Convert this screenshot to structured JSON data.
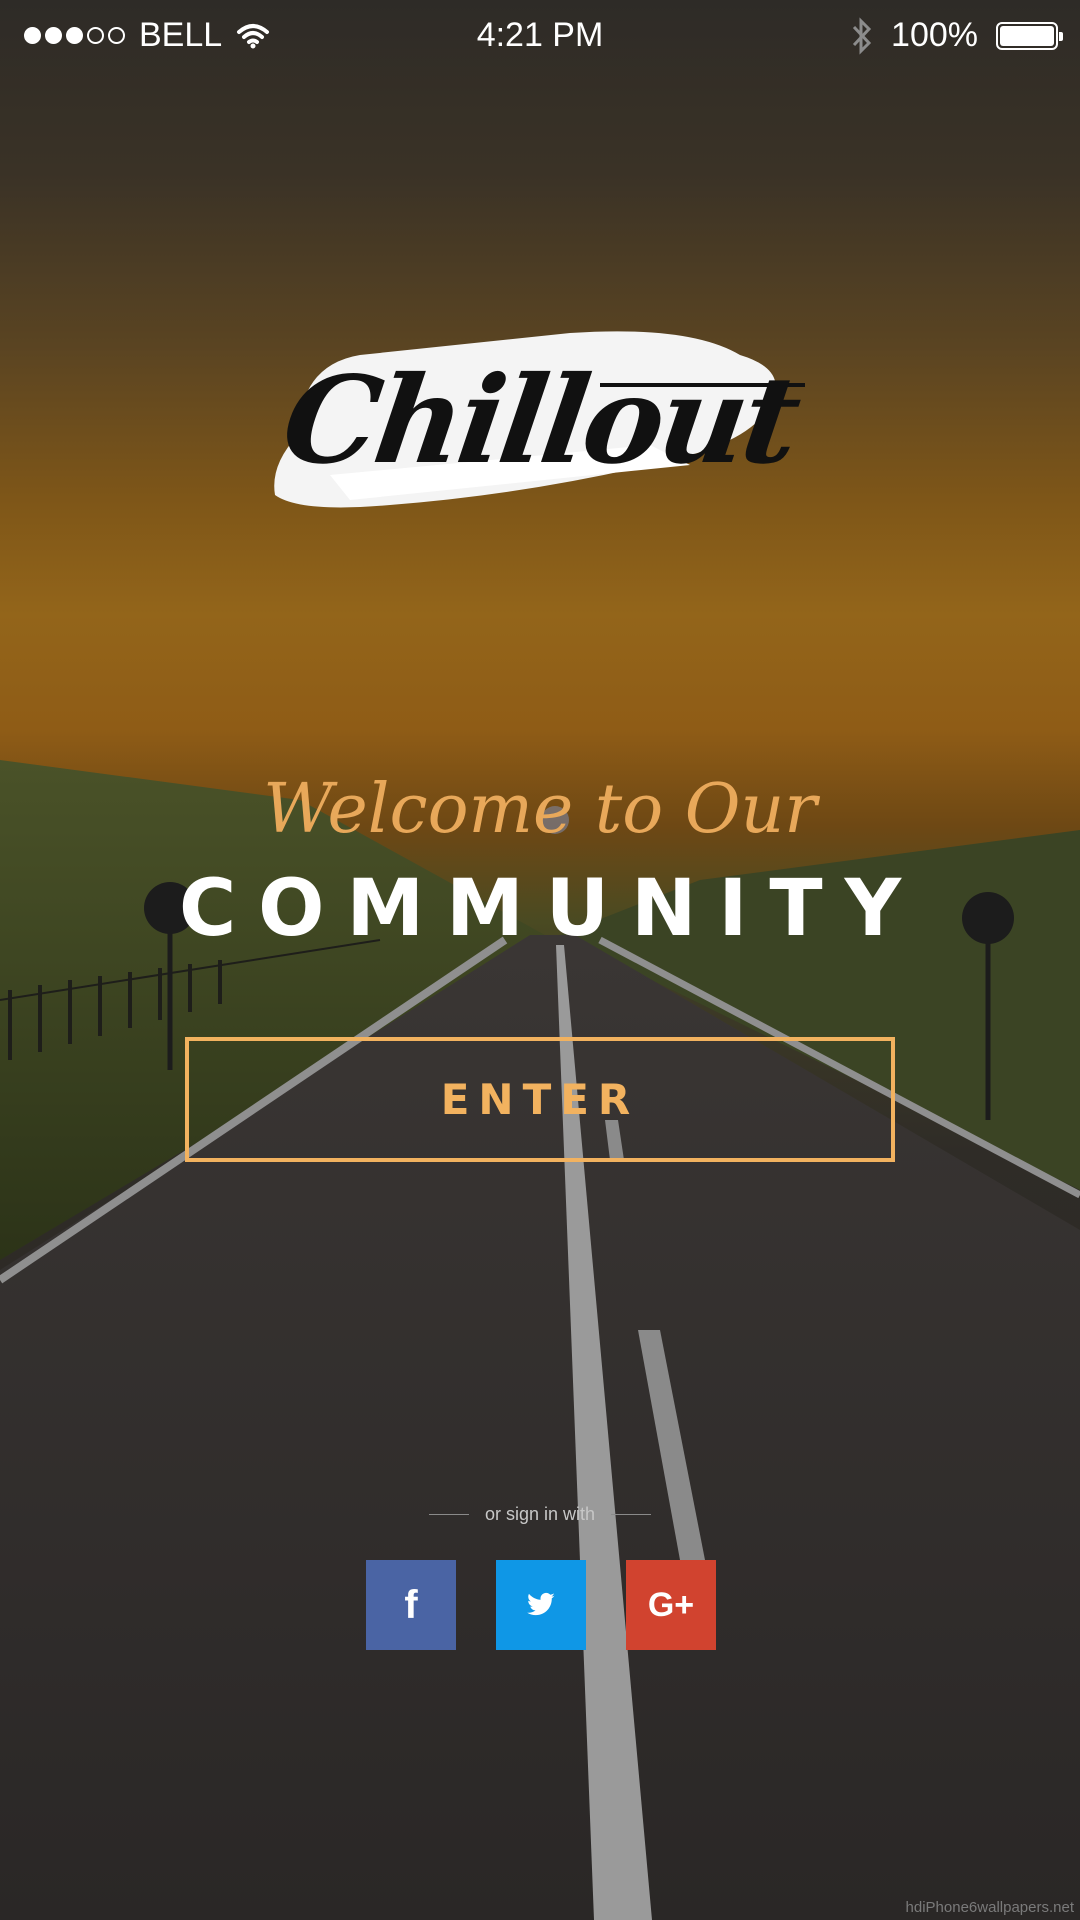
{
  "statusbar": {
    "carrier": "BELL",
    "time": "4:21 PM",
    "battery": "100%",
    "signal_filled": 3,
    "signal_total": 5,
    "icons": [
      "wifi-icon",
      "bluetooth-icon",
      "battery-icon"
    ]
  },
  "logo": {
    "text": "Chillout"
  },
  "hero": {
    "welcome": "Welcome to Our",
    "headline": "COMMUNITY"
  },
  "enter_button": {
    "label": "ENTER"
  },
  "social": {
    "divider_text": "or sign in with",
    "buttons": [
      {
        "name": "facebook",
        "glyph": "f",
        "color": "#4a64a4"
      },
      {
        "name": "twitter",
        "glyph": "twitter-bird",
        "color": "#0f97e6"
      },
      {
        "name": "google-plus",
        "glyph": "G+",
        "color": "#d1432f"
      }
    ]
  },
  "watermark": "hdiPhone6wallpapers.net",
  "colors": {
    "accent": "#f2b25f",
    "welcome": "#e8a85a"
  }
}
